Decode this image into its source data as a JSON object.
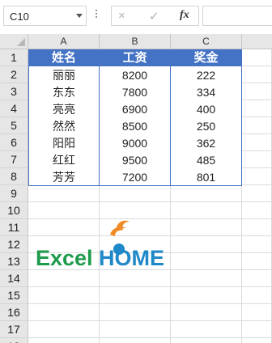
{
  "formula_bar": {
    "name_box": "C10",
    "cancel_icon": "×",
    "enter_icon": "✓",
    "fx_label": "fx",
    "formula_value": ""
  },
  "columns": [
    "A",
    "B",
    "C"
  ],
  "rows": [
    "1",
    "2",
    "3",
    "4",
    "5",
    "6",
    "7",
    "8",
    "9",
    "10",
    "11",
    "12",
    "13",
    "14",
    "15",
    "16",
    "17",
    "18"
  ],
  "table": {
    "headers": [
      "姓名",
      "工资",
      "奖金"
    ],
    "rows": [
      [
        "丽丽",
        "8200",
        "222"
      ],
      [
        "东东",
        "7800",
        "334"
      ],
      [
        "亮亮",
        "6900",
        "400"
      ],
      [
        "然然",
        "8500",
        "250"
      ],
      [
        "阳阳",
        "9000",
        "362"
      ],
      [
        "红红",
        "9500",
        "485"
      ],
      [
        "芳芳",
        "7200",
        "801"
      ]
    ]
  },
  "logo": {
    "text_green": "Excel",
    "text_blue": "HOME"
  },
  "colors": {
    "table_header_bg": "#4472c4",
    "table_border": "#4472c4",
    "logo_green": "#1e9b4b",
    "logo_blue": "#1e88c8",
    "logo_orange": "#f08a24"
  }
}
